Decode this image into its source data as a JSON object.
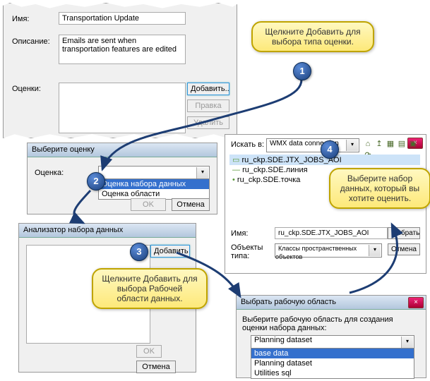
{
  "top": {
    "nameLabel": "Имя:",
    "nameValue": "Transportation Update",
    "descLabel": "Описание:",
    "descValue": "Emails are sent when transportation features are edited",
    "evalLabel": "Оценки:",
    "addBtn": "Добавить..",
    "editBtn": "Правка",
    "deleteBtn": "Удалить"
  },
  "p2": {
    "title": "Выберите оценку",
    "label": "Оценка:",
    "opt1": "Оценка набора данных",
    "opt2": "Оценка области",
    "ok": "OK",
    "cancel": "Отмена"
  },
  "p3": {
    "title": "Анализатор набора данных",
    "addBtn": "Добавить",
    "ok": "OK",
    "cancel": "Отмена"
  },
  "p4": {
    "lookLabel": "Искать в:",
    "lookValue": "WMX data connection",
    "item1": "ru_ckp.SDE.JTX_JOBS_AOI",
    "item2": "ru_ckp.SDE.линия",
    "item3": "ru_ckp.SDE.точка",
    "nameLabel": "Имя:",
    "nameValue": "ru_ckp.SDE.JTX_JOBS_AOI",
    "typeLabel": "Объекты типа:",
    "typeValue": "Классы пространственных объектов",
    "selectBtn": "Выбрать",
    "cancelBtn": "Отмена"
  },
  "p5": {
    "title": "Выбрать рабочую область",
    "instr": "Выберите рабочую область для создания оценки набора данных:",
    "selected": "Planning dataset",
    "opt1": "base data",
    "opt2": "Planning dataset",
    "opt3": "Utilities sql"
  },
  "call1": "Щелкните Добавить для выбора типа оценки.",
  "call3": "Щелкните Добавить для выбора Рабочей области данных.",
  "call4": "Выберите набор данных, который вы хотите оценить.",
  "steps": {
    "s1": "1",
    "s2": "2",
    "s3": "3",
    "s4": "4"
  }
}
